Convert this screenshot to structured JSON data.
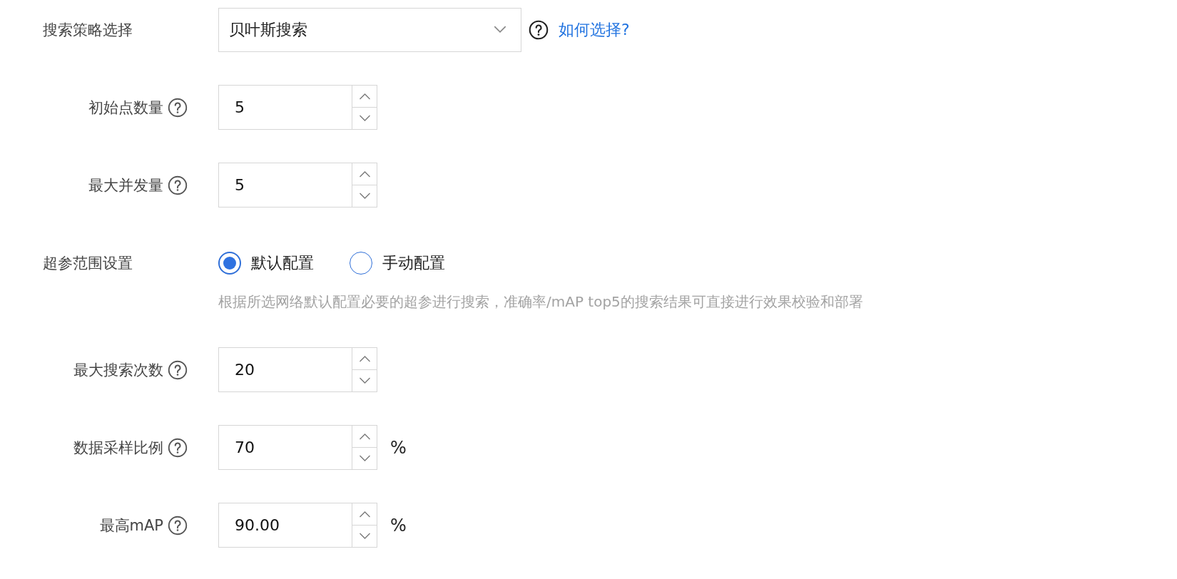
{
  "fields": [
    {
      "kind": "select",
      "label": "搜索策略选择",
      "help": false,
      "value": "贝叶斯搜索",
      "link_help": true,
      "link": "如何选择?"
    },
    {
      "kind": "number",
      "label": "初始点数量",
      "help": true,
      "value": "5"
    },
    {
      "kind": "number",
      "label": "最大并发量",
      "help": true,
      "value": "5"
    },
    {
      "kind": "radio",
      "label": "超参范围设置",
      "help": false,
      "options": [
        {
          "label": "默认配置",
          "selected": true
        },
        {
          "label": "手动配置",
          "selected": false
        }
      ],
      "hint": "根据所选网络默认配置必要的超参进行搜索，准确率/mAP top5的搜索结果可直接进行效果校验和部署"
    },
    {
      "kind": "number",
      "label": "最大搜索次数",
      "help": true,
      "value": "20"
    },
    {
      "kind": "number",
      "label": "数据采样比例",
      "help": true,
      "value": "70",
      "unit": "%"
    },
    {
      "kind": "number",
      "label": "最高mAP",
      "help": true,
      "value": "90.00",
      "unit": "%"
    }
  ]
}
